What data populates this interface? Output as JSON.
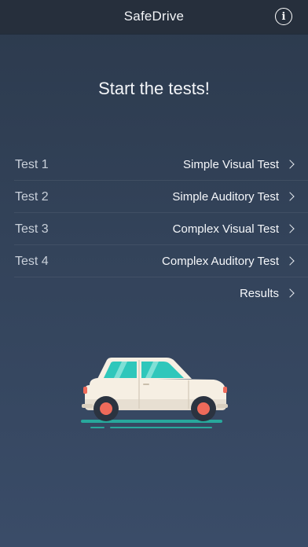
{
  "navbar": {
    "title": "SafeDrive",
    "info_icon": "info-icon"
  },
  "headline": "Start the tests!",
  "menu": {
    "items": [
      {
        "label": "Test 1",
        "value": "Simple Visual Test"
      },
      {
        "label": "Test 2",
        "value": "Simple Auditory Test"
      },
      {
        "label": "Test 3",
        "value": "Complex Visual Test"
      },
      {
        "label": "Test 4",
        "value": "Complex Auditory Test"
      },
      {
        "label": "",
        "value": "Results"
      }
    ]
  },
  "illustration": {
    "name": "car-illustration",
    "colors": {
      "body": "#f6efe3",
      "windows": "#2fc7bb",
      "wheels": "#ef6a5a",
      "ground": "#28a89c"
    }
  },
  "colors": {
    "navbar": "#262f3c",
    "background_top": "#2c3a4d",
    "background_bottom": "#3a4c68",
    "text": "#ffffff"
  }
}
